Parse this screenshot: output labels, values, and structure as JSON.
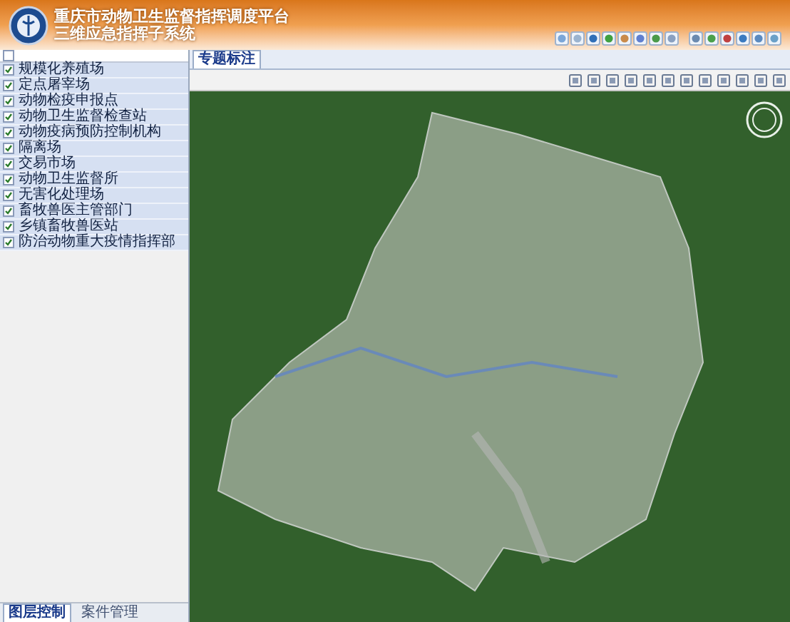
{
  "header": {
    "title": "重庆市动物卫生监督指挥调度平台",
    "subtitle": "三维应急指挥子系统"
  },
  "layers": {
    "all_checked": false,
    "items": [
      {
        "label": "规模化养殖场",
        "checked": true
      },
      {
        "label": "定点屠宰场",
        "checked": true
      },
      {
        "label": "动物检疫申报点",
        "checked": true
      },
      {
        "label": "动物卫生监督检查站",
        "checked": true
      },
      {
        "label": "动物疫病预防控制机构",
        "checked": true
      },
      {
        "label": "隔离场",
        "checked": true
      },
      {
        "label": "交易市场",
        "checked": true
      },
      {
        "label": "动物卫生监督所",
        "checked": true
      },
      {
        "label": "无害化处理场",
        "checked": true
      },
      {
        "label": "畜牧兽医主管部门",
        "checked": true
      },
      {
        "label": "乡镇畜牧兽医站",
        "checked": true
      },
      {
        "label": "防治动物重大疫情指挥部",
        "checked": true
      }
    ]
  },
  "bottom_tabs": [
    {
      "label": "图层控制",
      "selected": true
    },
    {
      "label": "案件管理",
      "selected": false
    }
  ],
  "map_tabs": [
    {
      "label": "专题标注",
      "selected": true
    }
  ]
}
